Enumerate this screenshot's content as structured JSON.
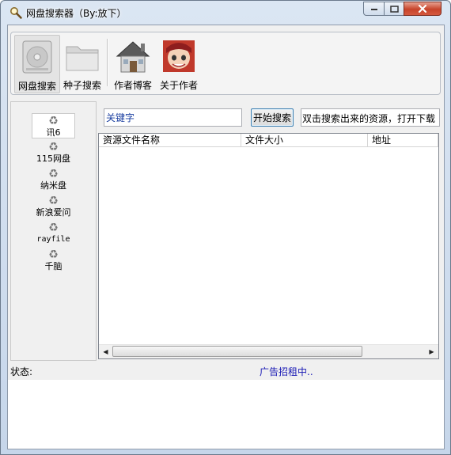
{
  "window": {
    "title": "网盘搜索器（By:放下）"
  },
  "toolbar": {
    "items": [
      {
        "label": "网盘搜索",
        "icon": "hard-drive-icon",
        "selected": true
      },
      {
        "label": "种子搜索",
        "icon": "folder-icon",
        "selected": false
      },
      {
        "label": "作者博客",
        "icon": "house-icon",
        "selected": false
      },
      {
        "label": "关于作者",
        "icon": "anime-avatar-icon",
        "selected": false
      }
    ]
  },
  "sources": {
    "items": [
      {
        "label": "讯6",
        "icon": "recycle-icon",
        "selected": true
      },
      {
        "label": "115网盘",
        "icon": "recycle-icon",
        "selected": false
      },
      {
        "label": "纳米盘",
        "icon": "recycle-icon",
        "selected": false
      },
      {
        "label": "新浪爱问",
        "icon": "recycle-icon",
        "selected": false
      },
      {
        "label": "rayfile",
        "icon": "recycle-icon",
        "selected": false
      },
      {
        "label": "千脑",
        "icon": "recycle-icon",
        "selected": false
      }
    ]
  },
  "search": {
    "value": "关键字",
    "button_label": "开始搜索",
    "hint": "双击搜索出来的资源，打开下载"
  },
  "results": {
    "columns": [
      "资源文件名称",
      "文件大小",
      "地址"
    ],
    "rows": []
  },
  "status": {
    "label": "状态:",
    "ad_text": "广告招租中.."
  },
  "colors": {
    "ad_text": "#1a1ab5",
    "search_text": "#1a3ea0",
    "close_button": "#c7442a"
  }
}
